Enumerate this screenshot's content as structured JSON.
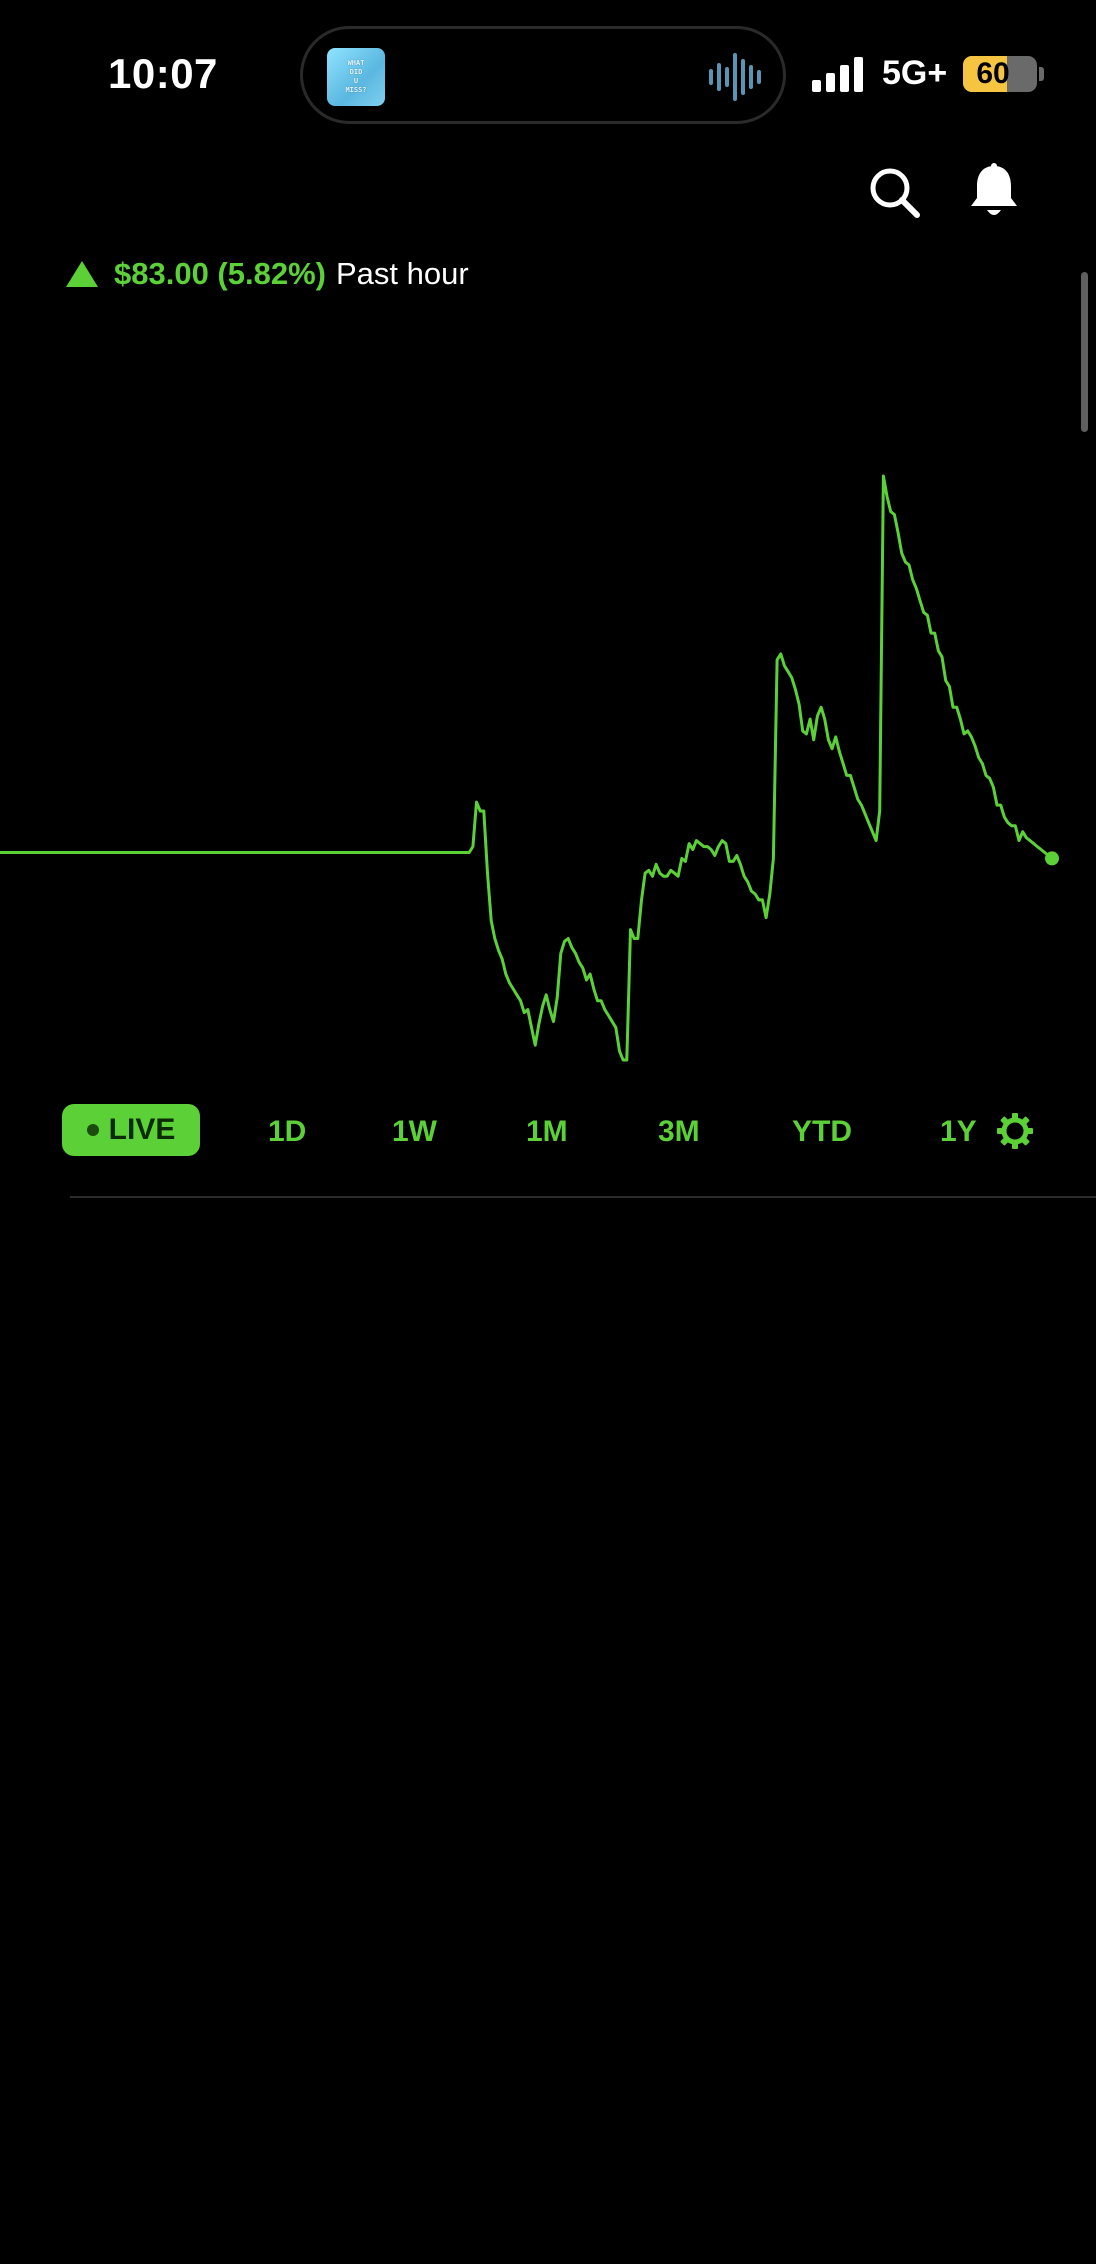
{
  "status_bar": {
    "time": "10:07",
    "now_playing_art_text": [
      "WHAT",
      "DID",
      "U",
      "MISS?"
    ],
    "network": "5G+",
    "battery_level": "60",
    "battery_fraction": 0.6
  },
  "header": {
    "search_icon": "search-icon",
    "notifications_icon": "bell-icon"
  },
  "change": {
    "direction": "up",
    "value": "$83.00 (5.82%)",
    "period": "Past hour",
    "color": "#5cd137"
  },
  "ranges": {
    "live": "LIVE",
    "d1": "1D",
    "w1": "1W",
    "m1": "1M",
    "m3": "3M",
    "ytd": "YTD",
    "y1": "1Y",
    "selected": "LIVE",
    "settings_icon": "gear-icon"
  },
  "chart_data": {
    "type": "line",
    "line_color": "#5cd137",
    "values": [
      40,
      40,
      40,
      40,
      40,
      40,
      40,
      40,
      40,
      40,
      40,
      40,
      40,
      40,
      40,
      40,
      40,
      40,
      40,
      40,
      40,
      40,
      40,
      40,
      40,
      40,
      40,
      40,
      40,
      40,
      40,
      40,
      40,
      40,
      40,
      40,
      40,
      40,
      40,
      40,
      40,
      40,
      40,
      40,
      40,
      40,
      40,
      40,
      40,
      40,
      40,
      40,
      40,
      40,
      40,
      40,
      40,
      40,
      40,
      40,
      40,
      40,
      40,
      40,
      40,
      40,
      40,
      40,
      40,
      40,
      40,
      40,
      40,
      40,
      40,
      40,
      40,
      40,
      40,
      40,
      40,
      40,
      40,
      40,
      40,
      40,
      40,
      40,
      40,
      40,
      40,
      40,
      40,
      40,
      40,
      40,
      40,
      40,
      40,
      40,
      40,
      40,
      40,
      40,
      40,
      40,
      40,
      40,
      40,
      40,
      40,
      40,
      40,
      40,
      40,
      40,
      40,
      40,
      40,
      40,
      40,
      40,
      40,
      40,
      40,
      40,
      40,
      40,
      40,
      42,
      57,
      54,
      54,
      33,
      17,
      11,
      7,
      4,
      -1,
      -4,
      -6,
      -8,
      -10,
      -14,
      -13,
      -19,
      -25,
      -18,
      -12,
      -8,
      -13,
      -17,
      -9,
      6,
      10,
      11,
      8,
      6,
      3,
      1,
      -3,
      -1,
      -6,
      -10,
      -10,
      -13,
      -15,
      -17,
      -19,
      -27,
      -30,
      -30,
      14,
      11,
      11,
      24,
      33,
      34,
      32,
      36,
      33,
      32,
      32,
      34,
      33,
      32,
      38,
      37,
      43,
      41,
      44,
      43,
      42,
      42,
      41,
      39,
      42,
      44,
      43,
      37,
      37,
      39,
      36,
      32,
      30,
      27,
      26,
      24,
      24,
      18,
      26,
      38,
      105,
      107,
      103,
      101,
      99,
      95,
      90,
      81,
      80,
      85,
      78,
      86,
      89,
      85,
      78,
      75,
      79,
      74,
      70,
      66,
      66,
      62,
      58,
      56,
      53,
      50,
      47,
      44,
      54,
      167,
      160,
      155,
      154,
      148,
      141,
      138,
      137,
      132,
      129,
      125,
      121,
      120,
      114,
      114,
      108,
      106,
      98,
      96,
      89,
      89,
      85,
      80,
      81,
      79,
      76,
      72,
      70,
      66,
      65,
      62,
      56,
      56,
      52,
      50,
      49,
      49,
      44,
      47,
      45,
      44,
      43,
      42,
      41,
      40,
      39,
      38
    ]
  }
}
